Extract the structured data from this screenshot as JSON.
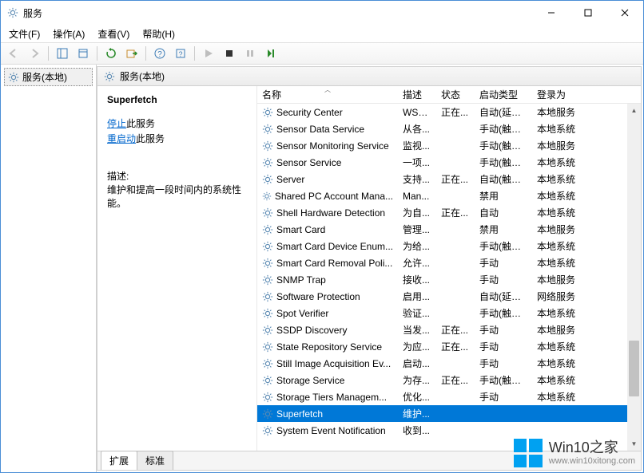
{
  "window": {
    "title": "服务"
  },
  "menu": {
    "file": "文件(F)",
    "action": "操作(A)",
    "view": "查看(V)",
    "help": "帮助(H)"
  },
  "tree": {
    "root": "服务(本地)"
  },
  "rightHeader": "服务(本地)",
  "detail": {
    "selectedName": "Superfetch",
    "stopLink": "停止",
    "stopSuffix": "此服务",
    "restartLink": "重启动",
    "restartSuffix": "此服务",
    "descLabel": "描述:",
    "descText": "维护和提高一段时间内的系统性能。"
  },
  "columns": {
    "name": "名称",
    "desc": "描述",
    "status": "状态",
    "startup": "启动类型",
    "logon": "登录为"
  },
  "icon": {
    "gear": "gear-icon"
  },
  "rows": [
    {
      "name": "Security Center",
      "desc": "WSC...",
      "status": "正在...",
      "start": "自动(延迟...",
      "logon": "本地服务"
    },
    {
      "name": "Sensor Data Service",
      "desc": "从各...",
      "status": "",
      "start": "手动(触发...",
      "logon": "本地系统"
    },
    {
      "name": "Sensor Monitoring Service",
      "desc": "监视...",
      "status": "",
      "start": "手动(触发...",
      "logon": "本地服务"
    },
    {
      "name": "Sensor Service",
      "desc": "一项...",
      "status": "",
      "start": "手动(触发...",
      "logon": "本地系统"
    },
    {
      "name": "Server",
      "desc": "支持...",
      "status": "正在...",
      "start": "自动(触发...",
      "logon": "本地系统"
    },
    {
      "name": "Shared PC Account Mana...",
      "desc": "Man...",
      "status": "",
      "start": "禁用",
      "logon": "本地系统"
    },
    {
      "name": "Shell Hardware Detection",
      "desc": "为自...",
      "status": "正在...",
      "start": "自动",
      "logon": "本地系统"
    },
    {
      "name": "Smart Card",
      "desc": "管理...",
      "status": "",
      "start": "禁用",
      "logon": "本地服务"
    },
    {
      "name": "Smart Card Device Enum...",
      "desc": "为给...",
      "status": "",
      "start": "手动(触发...",
      "logon": "本地系统"
    },
    {
      "name": "Smart Card Removal Poli...",
      "desc": "允许...",
      "status": "",
      "start": "手动",
      "logon": "本地系统"
    },
    {
      "name": "SNMP Trap",
      "desc": "接收...",
      "status": "",
      "start": "手动",
      "logon": "本地服务"
    },
    {
      "name": "Software Protection",
      "desc": "启用...",
      "status": "",
      "start": "自动(延迟...",
      "logon": "网络服务"
    },
    {
      "name": "Spot Verifier",
      "desc": "验证...",
      "status": "",
      "start": "手动(触发...",
      "logon": "本地系统"
    },
    {
      "name": "SSDP Discovery",
      "desc": "当发...",
      "status": "正在...",
      "start": "手动",
      "logon": "本地服务"
    },
    {
      "name": "State Repository Service",
      "desc": "为应...",
      "status": "正在...",
      "start": "手动",
      "logon": "本地系统"
    },
    {
      "name": "Still Image Acquisition Ev...",
      "desc": "启动...",
      "status": "",
      "start": "手动",
      "logon": "本地系统"
    },
    {
      "name": "Storage Service",
      "desc": "为存...",
      "status": "正在...",
      "start": "手动(触发...",
      "logon": "本地系统"
    },
    {
      "name": "Storage Tiers Managem...",
      "desc": "优化...",
      "status": "",
      "start": "手动",
      "logon": "本地系统"
    },
    {
      "name": "Superfetch",
      "desc": "维护...",
      "status": "",
      "start": "",
      "logon": "",
      "selected": true
    },
    {
      "name": "System Event Notification",
      "desc": "收到...",
      "status": "",
      "start": "",
      "logon": ""
    }
  ],
  "tabs": {
    "extended": "扩展",
    "standard": "标准"
  },
  "watermark": {
    "big": "Win10之家",
    "small": "www.win10xitong.com"
  },
  "controls": {
    "min": "—",
    "max": "▢",
    "close": "✕",
    "back": "⇐",
    "forward": "⇒",
    "up": "⇧",
    "refresh": "↻",
    "export": "⇨",
    "help": "?",
    "stop": "■",
    "pause": "❚❚",
    "play": "▶",
    "restart": "⟳"
  }
}
